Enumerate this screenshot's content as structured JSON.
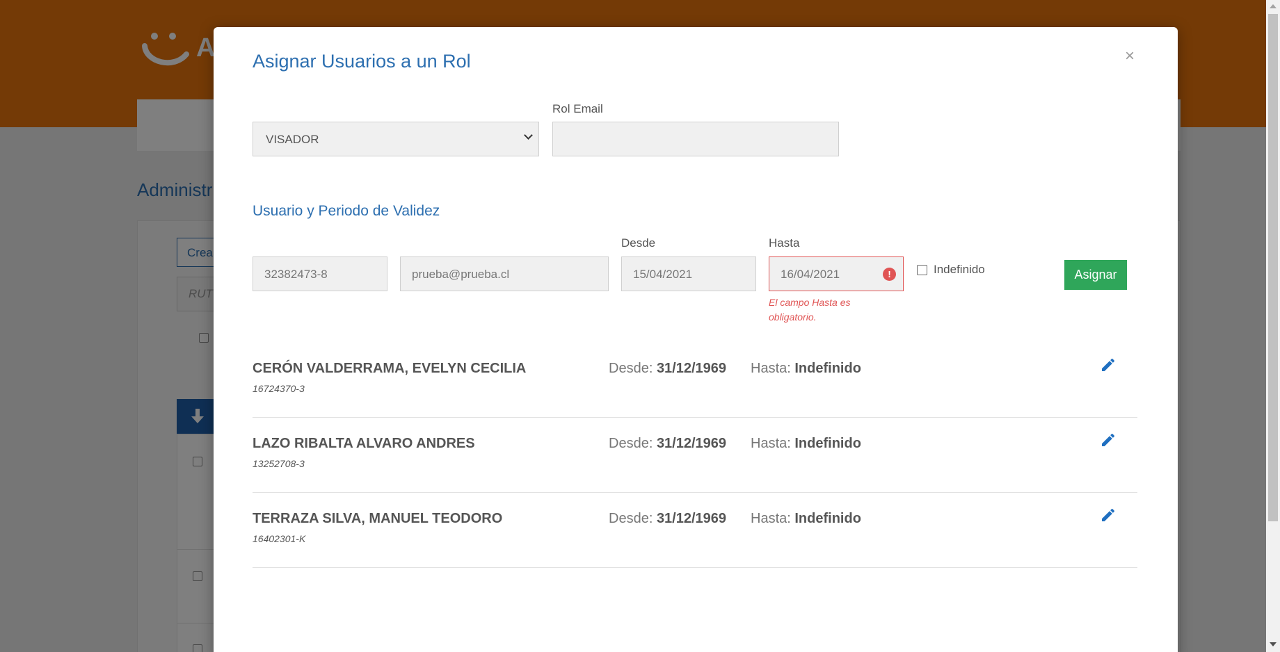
{
  "background": {
    "brand_partial": "A",
    "admin_title_partial": "Administr",
    "create_button_partial": "Crea",
    "rut_placeholder_partial": "RUT",
    "download_icon": "arrow-down-icon"
  },
  "modal": {
    "title": "Asignar Usuarios a un Rol",
    "close_label": "×",
    "role_select": {
      "selected": "VISADOR"
    },
    "role_email": {
      "label": "Rol Email",
      "value": ""
    },
    "section_title": "Usuario y Periodo de Validez",
    "rut_input": {
      "value": "32382473-8"
    },
    "email_input": {
      "value": "prueba@prueba.cl"
    },
    "desde": {
      "label": "Desde",
      "value": "15/04/2021"
    },
    "hasta": {
      "label": "Hasta",
      "value": "16/04/2021",
      "error_icon": "!",
      "error_message": "El campo Hasta es obligatorio."
    },
    "indefinido_label": "Indefinido",
    "assign_button": "Asignar",
    "users": [
      {
        "name": "CERÓN VALDERRAMA, EVELYN CECILIA",
        "rut": "16724370-3",
        "desde_label": "Desde:",
        "desde": "31/12/1969",
        "hasta_label": "Hasta:",
        "hasta": "Indefinido"
      },
      {
        "name": "LAZO RIBALTA ALVARO ANDRES",
        "rut": "13252708-3",
        "desde_label": "Desde:",
        "desde": "31/12/1969",
        "hasta_label": "Hasta:",
        "hasta": "Indefinido"
      },
      {
        "name": "TERRAZA SILVA, MANUEL TEODORO",
        "rut": "16402301-K",
        "desde_label": "Desde:",
        "desde": "31/12/1969",
        "hasta_label": "Hasta:",
        "hasta": "Indefinido"
      }
    ]
  },
  "colors": {
    "brand_orange": "#e8740d",
    "link_blue": "#2d6fb0",
    "assign_green": "#2fa65a",
    "error_red": "#e05454"
  }
}
